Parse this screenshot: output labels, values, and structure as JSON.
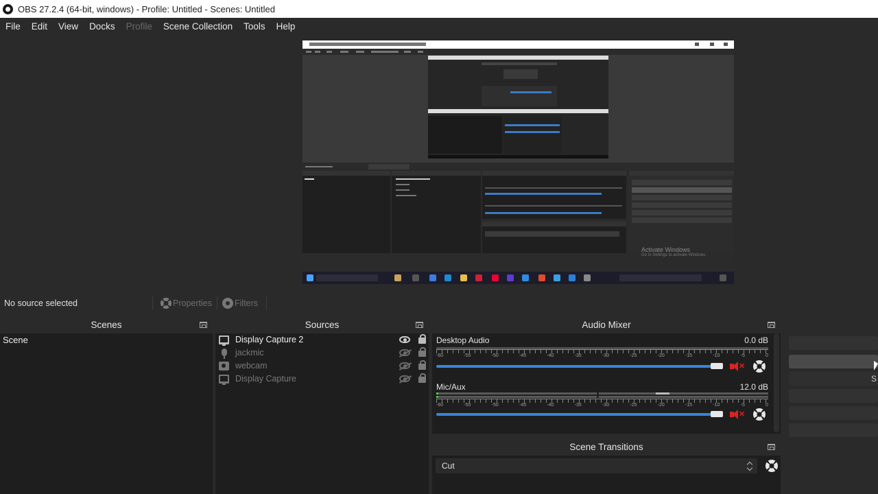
{
  "window": {
    "title": "OBS 27.2.4 (64-bit, windows) - Profile: Untitled - Scenes: Untitled"
  },
  "menu": {
    "file": "File",
    "edit": "Edit",
    "view": "View",
    "docks": "Docks",
    "profile": "Profile",
    "scene_collection": "Scene Collection",
    "tools": "Tools",
    "help": "Help"
  },
  "preview": {
    "watermark_title": "Activate Windows",
    "watermark_sub": "Go to Settings to activate Windows."
  },
  "toolbar": {
    "status": "No source selected",
    "properties": "Properties",
    "filters": "Filters"
  },
  "scenes": {
    "title": "Scenes",
    "items": [
      "Scene"
    ]
  },
  "sources": {
    "title": "Sources",
    "items": [
      {
        "name": "Display Capture 2",
        "icon": "monitor-icon",
        "visible": true
      },
      {
        "name": "jackmic",
        "icon": "microphone-icon",
        "visible": false
      },
      {
        "name": "webcam",
        "icon": "camera-icon",
        "visible": false
      },
      {
        "name": "Display Capture",
        "icon": "monitor-icon",
        "visible": false
      }
    ]
  },
  "mixer": {
    "title": "Audio Mixer",
    "tick_labels": [
      "-60",
      "-55",
      "-50",
      "-45",
      "-40",
      "-35",
      "-30",
      "-25",
      "-20",
      "-15",
      "-10",
      "-5",
      "0"
    ],
    "channels": [
      {
        "name": "Desktop Audio",
        "db": "0.0 dB",
        "volume_fraction": 1.0,
        "muted": true
      },
      {
        "name": "Mic/Aux",
        "db": "12.0 dB",
        "volume_fraction": 1.0,
        "muted": true
      }
    ]
  },
  "transitions": {
    "title": "Scene Transitions",
    "selected": "Cut"
  },
  "controls": {
    "partial_label": "S"
  },
  "colors": {
    "accent_blue": "#3a84d8",
    "mute_red": "#dd2222",
    "dock_bg": "#1e1e1e",
    "window_bg": "#2a2a2a"
  }
}
